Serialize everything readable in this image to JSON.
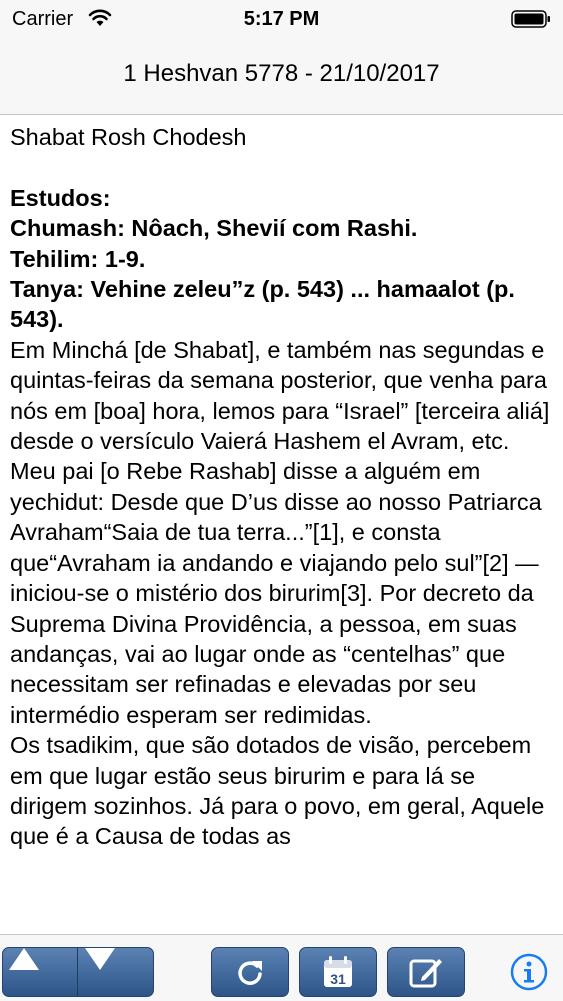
{
  "status_bar": {
    "carrier": "Carrier",
    "time": "5:17 PM"
  },
  "nav": {
    "title": "1 Heshvan 5778 - 21/10/2017"
  },
  "content": {
    "subtitle": "Shabat Rosh Chodesh",
    "study_heading": "Estudos:",
    "chumash": "Chumash: Nôach, Shevií com Rashi.",
    "tehilim": "Tehilim: 1-9.",
    "tanya": "Tanya: Vehine zeleu”z (p. 543) ... hamaalot (p. 543).",
    "paragraph1": "Em Minchá [de Shabat], e também nas segundas e quintas-feiras da semana posterior, que venha para nós em [boa] hora, lemos para “Israel” [terceira aliá] desde o versículo Vaierá Hashem el Avram, etc.",
    "paragraph2": "Meu pai [o Rebe Rashab] disse a alguém em yechidut: Desde que D’us disse ao nosso Patriarca Avraham“Saia de tua terra...”[1], e consta que“Avraham ia andando e viajando pelo sul”[2] — iniciou-se o mistério dos birurim[3]. Por decreto da Suprema Divina Providência, a pessoa, em suas andanças, vai ao lugar onde as “centelhas” que necessitam ser refinadas e elevadas por seu intermédio esperam ser redimidas.",
    "paragraph3": "Os tsadikim, que são dotados de visão, percebem em que lugar estão seus birurim e para lá se dirigem sozinhos. Já para o povo, em geral, Aquele que é a Causa de todas as"
  },
  "toolbar": {
    "calendar_day": "31",
    "icons": [
      "arrow-up-icon",
      "arrow-down-icon",
      "refresh-icon",
      "calendar-icon",
      "edit-icon",
      "info-icon"
    ],
    "button_color": "#3d679c",
    "info_color": "#1a7cf0"
  }
}
